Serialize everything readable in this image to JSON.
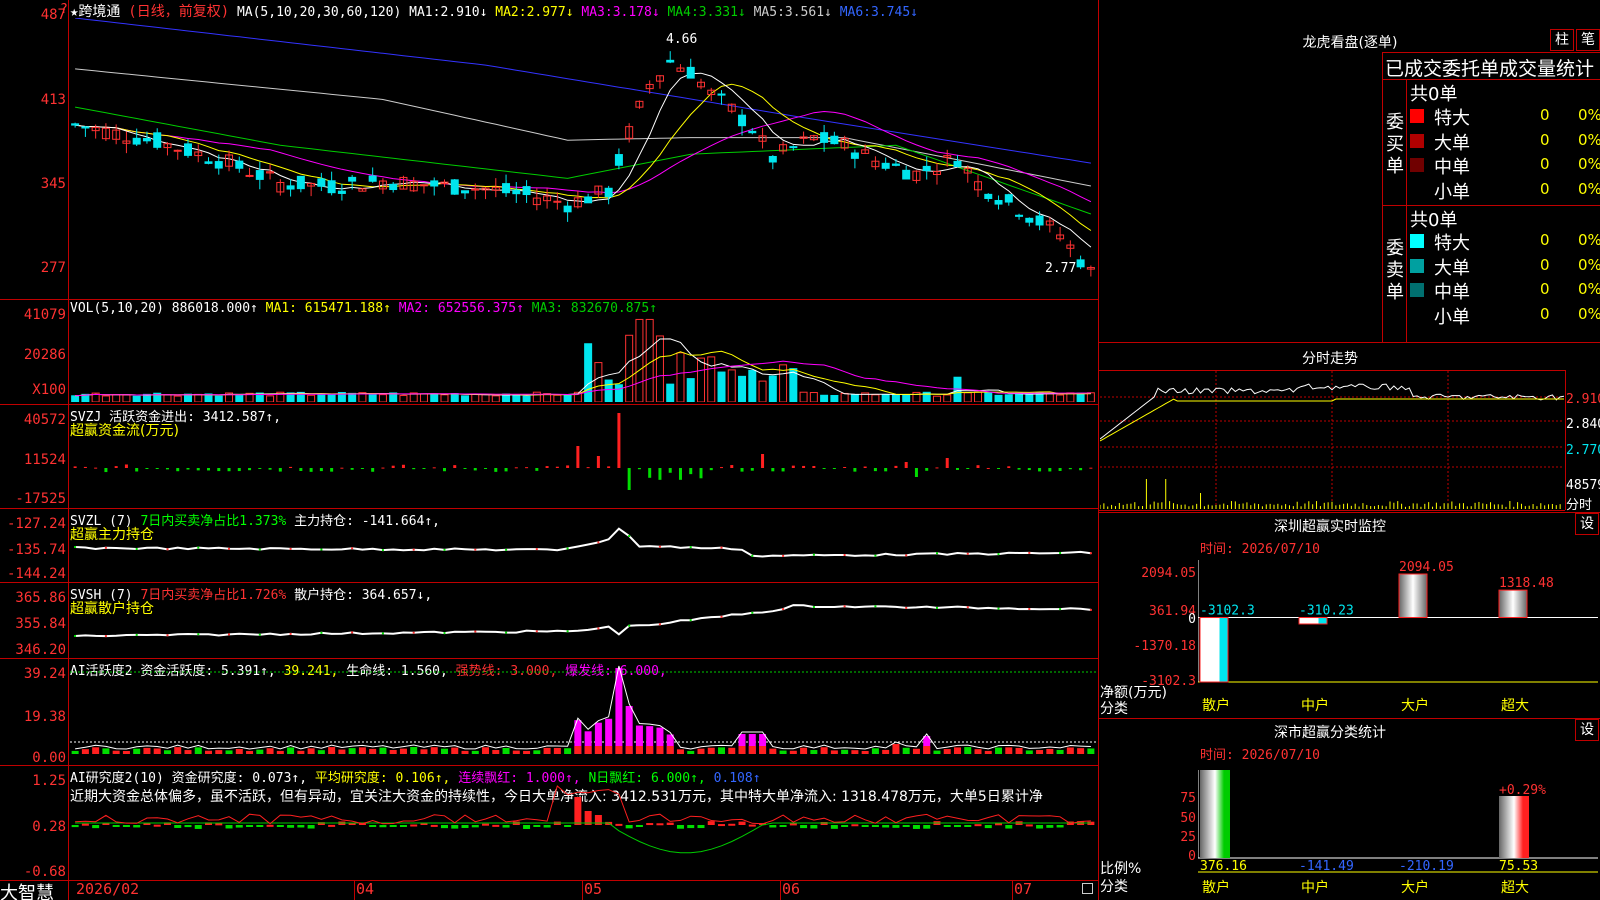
{
  "stock": {
    "name": "★跨境通",
    "period": "(日线，前复权)"
  },
  "colors": {
    "up": "#ff3232",
    "down": "#00e5ee",
    "ma1": "#ffffff",
    "ma2": "#ffff00",
    "ma3": "#ff00ff",
    "ma4": "#00cc00",
    "ma5": "#cccccc",
    "ma6": "#3333ff"
  },
  "ma": {
    "params": "MA(5,10,20,30,60,120)",
    "ma1_label": "MA1:",
    "ma1_val": "2.910↓",
    "ma2_label": "MA2:",
    "ma2_val": "2.977↓",
    "ma3_label": "MA3:",
    "ma3_val": "3.178↓",
    "ma4_label": "MA4:",
    "ma4_val": "3.331↓",
    "ma5_label": "MA5:",
    "ma5_val": "3.561↓",
    "ma6_label": "MA6:",
    "ma6_val": "3.745↓"
  },
  "price_axis": [
    "487",
    "413",
    "345",
    "277"
  ],
  "price_high_label": "4.66",
  "price_low_label": "2.77",
  "vol": {
    "params": "VOL(5,10,20)",
    "val": "886018.000↑",
    "ma1": "MA1: 615471.188↑",
    "ma2": "MA2: 652556.375↑",
    "ma3": "MA3: 832670.875↑",
    "axis": [
      "41079",
      "20286",
      "X100"
    ]
  },
  "svzj": {
    "title": "SVZJ  活跃资金进出: 3412.587↑,",
    "sub": "超赢资金流(万元)",
    "axis": [
      "40572",
      "11524",
      "-17525"
    ]
  },
  "svzl": {
    "name": "SVZL (7)",
    "p1": "7日内买卖净占比1.373%",
    "p2": "主力持仓: -141.664↑,",
    "sub": "超赢主力持仓",
    "axis": [
      "-127.24",
      "-135.74",
      "-144.24"
    ]
  },
  "svsh": {
    "name": "SVSH (7)",
    "p1": "7日内买卖净占比1.726%",
    "p2": "散户持仓: 364.657↓,",
    "sub": "超赢散户持仓",
    "axis": [
      "365.86",
      "355.84",
      "346.20"
    ]
  },
  "ai1": {
    "name": "AI活跃度2",
    "p1": "资金活跃度: 5.391↑,",
    "p2": "39.241,",
    "p3": "生命线: 1.560,",
    "p4": "强势线: 3.000,",
    "p5": "爆发线: 6.000,",
    "axis": [
      "39.24",
      "19.38",
      "0.00"
    ]
  },
  "ai2": {
    "name": "AI研究度2(10)",
    "p1": "资金研究度: 0.073↑,",
    "p2": "平均研究度: 0.106↑,",
    "p3": "连续飘红: 1.000↑,",
    "p4": "N日飘红: 6.000↑,",
    "p5": "0.108↑",
    "desc": "近期大资金总体偏多，虽不活跃，但有异动，宜关注大资金的持续性，今日大单净流入: 3412.531万元，其中特大单净流入: 1318.478万元，大单5日累计净",
    "axis": [
      "1.25",
      "0.28",
      "-0.68"
    ]
  },
  "xaxis": [
    "2026/02",
    "04",
    "05",
    "06",
    "07"
  ],
  "brand": "大智慧",
  "lhb": {
    "title": "龙虎看盘(逐单)",
    "btn1": "柱",
    "btn2": "笔",
    "header": "已成交委托单成交量统计",
    "buy_label": "委买单",
    "buy_count": "共0单",
    "sell_label": "委卖单",
    "sell_count": "共0单",
    "buy_rows": [
      {
        "label": "特大",
        "n": "0",
        "p": "0%",
        "color": "#ff0000"
      },
      {
        "label": "大单",
        "n": "0",
        "p": "0%",
        "color": "#b00000"
      },
      {
        "label": "中单",
        "n": "0",
        "p": "0%",
        "color": "#700000"
      },
      {
        "label": "小单",
        "n": "0",
        "p": "0%",
        "color": "#000000"
      }
    ],
    "sell_rows": [
      {
        "label": "特大",
        "n": "0",
        "p": "0%",
        "color": "#00ffff"
      },
      {
        "label": "大单",
        "n": "0",
        "p": "0%",
        "color": "#00a0a0"
      },
      {
        "label": "中单",
        "n": "0",
        "p": "0%",
        "color": "#006f6f"
      },
      {
        "label": "小单",
        "n": "0",
        "p": "0%",
        "color": "#000000"
      }
    ]
  },
  "fenshi": {
    "title": "分时走势",
    "axis": [
      "2.910",
      "2.840",
      "2.770",
      "48579",
      "分时"
    ]
  },
  "monitor": {
    "title": "深圳超赢实时监控",
    "set": "设",
    "time": "时间: 2026/07/10",
    "axis": [
      "2094.05",
      "361.94",
      "0",
      "-1370.18",
      "-3102.3"
    ],
    "ylabel1": "净额(万元)",
    "ylabel2": "分类",
    "chart_data": {
      "type": "bar",
      "categories": [
        "散户",
        "中户",
        "大户",
        "超大"
      ],
      "values": [
        -3102.3,
        -310.23,
        2094.05,
        1318.48
      ],
      "labels": [
        "-3102.3",
        "-310.23",
        "2094.05",
        "1318.48"
      ],
      "ylim": [
        -3102.3,
        2094.05
      ]
    }
  },
  "classify": {
    "title": "深市超赢分类统计",
    "set": "设",
    "time": "时间: 2026/07/10",
    "axis": [
      "75",
      "50",
      "25",
      "0"
    ],
    "ylabel1": "比例%",
    "ylabel2": "分类",
    "chart_data": {
      "type": "bar",
      "categories": [
        "散户",
        "中户",
        "大户",
        "超大"
      ],
      "values": [
        376.16,
        -141.49,
        -210.19,
        75.53
      ],
      "pct_label": "+0.29%",
      "ylim": [
        0,
        75
      ]
    }
  }
}
